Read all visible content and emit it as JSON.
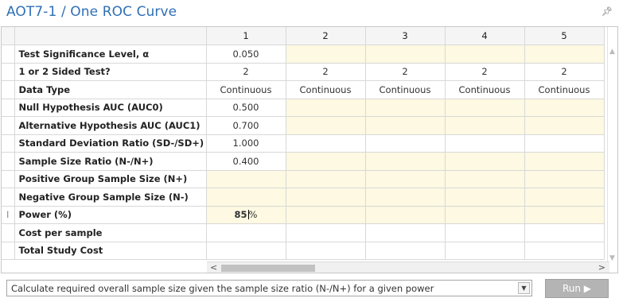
{
  "window": {
    "title": "AOT7-1 / One ROC Curve",
    "pin_icon": "pin-icon"
  },
  "grid": {
    "columns": [
      "1",
      "2",
      "3",
      "4",
      "5"
    ],
    "rows": [
      {
        "label": "Test Significance Level, α",
        "cells": [
          "0.050",
          "",
          "",
          "",
          ""
        ],
        "fill": [
          "w",
          "y",
          "y",
          "y",
          "y"
        ]
      },
      {
        "label": "1 or 2 Sided Test?",
        "cells": [
          "2",
          "2",
          "2",
          "2",
          "2"
        ],
        "fill": [
          "w",
          "w",
          "w",
          "w",
          "w"
        ]
      },
      {
        "label": "Data Type",
        "cells": [
          "Continuous",
          "Continuous",
          "Continuous",
          "Continuous",
          "Continuous"
        ],
        "fill": [
          "w",
          "w",
          "w",
          "w",
          "w"
        ]
      },
      {
        "label": "Null Hypothesis AUC (AUC0)",
        "cells": [
          "0.500",
          "",
          "",
          "",
          ""
        ],
        "fill": [
          "w",
          "y",
          "y",
          "y",
          "y"
        ]
      },
      {
        "label": "Alternative Hypothesis AUC (AUC1)",
        "cells": [
          "0.700",
          "",
          "",
          "",
          ""
        ],
        "fill": [
          "w",
          "y",
          "y",
          "y",
          "y"
        ]
      },
      {
        "label": "Standard Deviation Ratio (SD-/SD+)",
        "cells": [
          "1.000",
          "",
          "",
          "",
          ""
        ],
        "fill": [
          "w",
          "w",
          "w",
          "w",
          "w"
        ]
      },
      {
        "label": "Sample Size Ratio (N-/N+)",
        "cells": [
          "0.400",
          "",
          "",
          "",
          ""
        ],
        "fill": [
          "w",
          "y",
          "y",
          "y",
          "y"
        ]
      },
      {
        "label": "Positive Group Sample Size (N+)",
        "cells": [
          "",
          "",
          "",
          "",
          ""
        ],
        "fill": [
          "y",
          "y",
          "y",
          "y",
          "y"
        ]
      },
      {
        "label": "Negative Group Sample Size (N-)",
        "cells": [
          "",
          "",
          "",
          "",
          ""
        ],
        "fill": [
          "y",
          "y",
          "y",
          "y",
          "y"
        ]
      },
      {
        "label": "Power (%)",
        "cells": [
          "85",
          "",
          "",
          "",
          ""
        ],
        "fill": [
          "y",
          "y",
          "y",
          "y",
          "y"
        ],
        "active": true,
        "suffix": "%",
        "marker": "I"
      },
      {
        "label": "Cost per sample",
        "cells": [
          "",
          "",
          "",
          "",
          ""
        ],
        "fill": [
          "w",
          "w",
          "w",
          "w",
          "w"
        ]
      },
      {
        "label": "Total Study Cost",
        "cells": [
          "",
          "",
          "",
          "",
          ""
        ],
        "fill": [
          "w",
          "w",
          "w",
          "w",
          "w"
        ]
      }
    ],
    "colors": {
      "yellow": "#fdf9e2",
      "header": "#f5f5f5"
    }
  },
  "calc_select": {
    "value": "Calculate required overall sample size given the sample size ratio (N-/N+) for a given power"
  },
  "run_button": {
    "label": "Run ▶"
  },
  "accent": "#2f6fb5"
}
